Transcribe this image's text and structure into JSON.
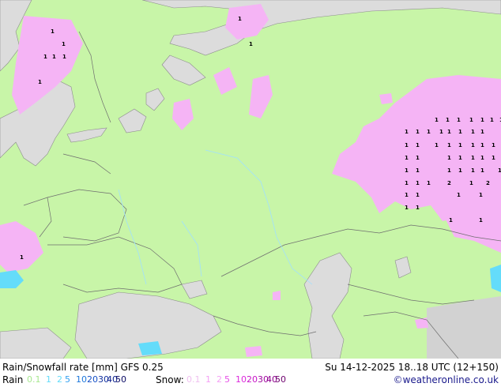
{
  "title": "Rain/Snowfall rate [mm]  GFS 0.25",
  "datetime": "Su 14-12-2025 18..18 UTC (12+150)",
  "credit": "©weatheronline.co.uk",
  "legend": {
    "rain_label": "Rain",
    "rain_levels": [
      {
        "label": "0.1",
        "color": "#c8f5a8"
      },
      {
        "label": "1",
        "color": "#64dcfa"
      },
      {
        "label": "2",
        "color": "#64dcfa"
      },
      {
        "label": "5",
        "color": "#32a0f0"
      },
      {
        "label": "10",
        "color": "#1e78dc"
      },
      {
        "label": "20",
        "color": "#1450c8"
      },
      {
        "label": "30",
        "color": "#1432a0"
      },
      {
        "label": "40",
        "color": "#0a1e8c"
      },
      {
        "label": "50",
        "color": "#0a0a64"
      }
    ],
    "snow_label": "Snow:",
    "snow_levels": [
      {
        "label": "0.1",
        "color": "#ffd2ff"
      },
      {
        "label": "1",
        "color": "#f5a0f5"
      },
      {
        "label": "2",
        "color": "#f5a0f5"
      },
      {
        "label": "5",
        "color": "#e650e6"
      },
      {
        "label": "10",
        "color": "#dc28dc"
      },
      {
        "label": "20",
        "color": "#c814c8"
      },
      {
        "label": "30",
        "color": "#a00aa0"
      },
      {
        "label": "40",
        "color": "#8c008c"
      },
      {
        "label": "50",
        "color": "#6e006e"
      }
    ]
  },
  "colors": {
    "land_no_precip": "#c8f5a8",
    "sea": "#dcdcdc",
    "snow_light": "#f5b4f5",
    "rain_light": "#64dcfa",
    "border": "#6e6e6e"
  },
  "map_values": [
    "1",
    "1",
    "1",
    "1",
    "1",
    "1",
    "1",
    "1",
    "1",
    "1",
    "1",
    "1",
    "1",
    "1",
    "1",
    "1",
    "1",
    "1",
    "1",
    "1",
    "1",
    "1",
    "1",
    "1",
    "1",
    "1",
    "1",
    "1",
    "1",
    "1",
    "1",
    "1",
    "1",
    "1",
    "1",
    "1",
    "1",
    "1",
    "1",
    "1",
    "1",
    "1",
    "1",
    "1",
    "1",
    "1",
    "1",
    "2",
    "1",
    "1",
    "2",
    "1",
    "1",
    "1",
    "1",
    "1",
    "1",
    "1",
    "1",
    "1"
  ]
}
